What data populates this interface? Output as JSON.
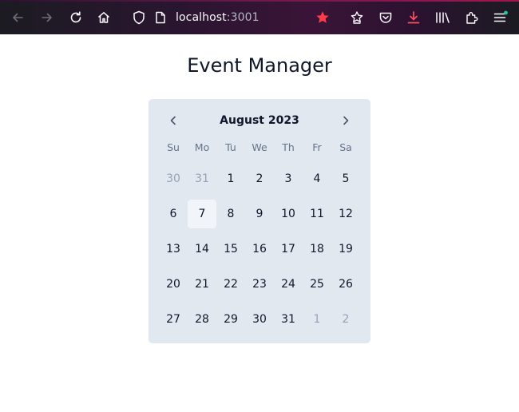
{
  "browser": {
    "url_host": "localhost",
    "url_port": ":3001",
    "icons": [
      "back-arrow-icon",
      "forward-arrow-icon",
      "reload-icon",
      "home-icon",
      "shield-icon",
      "page-icon",
      "bookmark-star-icon",
      "reader-star-icon",
      "pocket-icon",
      "download-icon",
      "library-icon",
      "extensions-icon",
      "menu-icon"
    ],
    "colors": {
      "bookmark_star": "#ff3b4a",
      "download": "#ff4f5e",
      "menu_dot": "#2ac3a2"
    }
  },
  "page": {
    "title": "Event Manager"
  },
  "calendar": {
    "month_label": "August 2023",
    "prev_icon": "chevron-left-icon",
    "next_icon": "chevron-right-icon",
    "weekdays": [
      "Su",
      "Mo",
      "Tu",
      "We",
      "Th",
      "Fr",
      "Sa"
    ],
    "weeks": [
      [
        {
          "d": "30",
          "out": true
        },
        {
          "d": "31",
          "out": true
        },
        {
          "d": "1"
        },
        {
          "d": "2"
        },
        {
          "d": "3"
        },
        {
          "d": "4"
        },
        {
          "d": "5"
        }
      ],
      [
        {
          "d": "6"
        },
        {
          "d": "7",
          "today": true
        },
        {
          "d": "8"
        },
        {
          "d": "9"
        },
        {
          "d": "10"
        },
        {
          "d": "11"
        },
        {
          "d": "12"
        }
      ],
      [
        {
          "d": "13"
        },
        {
          "d": "14"
        },
        {
          "d": "15"
        },
        {
          "d": "16"
        },
        {
          "d": "17"
        },
        {
          "d": "18"
        },
        {
          "d": "19"
        }
      ],
      [
        {
          "d": "20"
        },
        {
          "d": "21"
        },
        {
          "d": "22"
        },
        {
          "d": "23"
        },
        {
          "d": "24"
        },
        {
          "d": "25"
        },
        {
          "d": "26"
        }
      ],
      [
        {
          "d": "27"
        },
        {
          "d": "28"
        },
        {
          "d": "29"
        },
        {
          "d": "30"
        },
        {
          "d": "31"
        },
        {
          "d": "1",
          "out": true
        },
        {
          "d": "2",
          "out": true
        }
      ]
    ],
    "colors": {
      "background": "#e2e8f0",
      "today_bg": "#f1f5f9",
      "outside_text": "#94a3b8"
    }
  }
}
